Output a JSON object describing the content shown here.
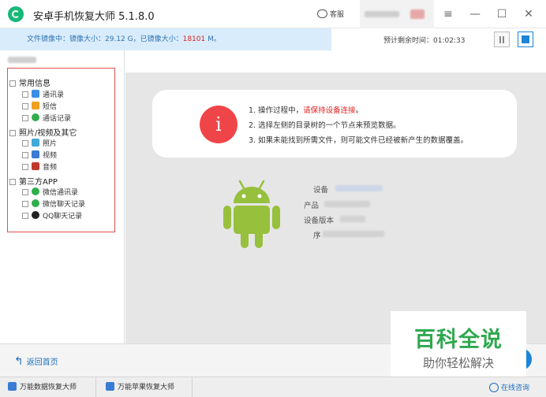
{
  "window": {
    "title": "安卓手机恢复大师  5.1.8.0",
    "support_label": "客服",
    "buttons": {
      "menu": "≡",
      "minimize": "—",
      "maximize": "☐",
      "close": "✕"
    }
  },
  "status": {
    "prefix": "文件镜像中：镜像大小：29.12 G，已镜像大小：",
    "mirrored_value": "18101",
    "suffix": " M。",
    "eta": "预计剩余时间：01:02:33"
  },
  "tree": {
    "categories": [
      {
        "label": "常用信息",
        "items": [
          {
            "label": "通讯录",
            "icon": "contacts-icon",
            "color": "#3a8ee6"
          },
          {
            "label": "短信",
            "icon": "sms-icon",
            "color": "#f0a020"
          },
          {
            "label": "通话记录",
            "icon": "call-log-icon",
            "color": "#2fae4a"
          }
        ]
      },
      {
        "label": "照片/视频及其它",
        "items": [
          {
            "label": "照片",
            "icon": "photo-icon",
            "color": "#3fa9d8"
          },
          {
            "label": "视频",
            "icon": "video-icon",
            "color": "#3a7bd5"
          },
          {
            "label": "音频",
            "icon": "audio-icon",
            "color": "#c0392b"
          }
        ]
      },
      {
        "label": "第三方APP",
        "items": [
          {
            "label": "微信通讯录",
            "icon": "wechat-icon",
            "color": "#2fae4a"
          },
          {
            "label": "微信聊天记录",
            "icon": "wechat-icon",
            "color": "#2fae4a"
          },
          {
            "label": "QQ聊天记录",
            "icon": "qq-icon",
            "color": "#222222"
          }
        ]
      }
    ]
  },
  "notice": {
    "line1_prefix": "1. 操作过程中，",
    "line1_red": "请保持设备连接",
    "line1_suffix": "。",
    "line2": "2. 选择左侧的目录树的一个节点来预览数据。",
    "line3": "3. 如果未能找到所需文件，则可能文件已经被新产生的数据覆盖。"
  },
  "device": {
    "label1": "设备",
    "label2": "产品",
    "label3": "设备版本",
    "label4": "序"
  },
  "footer": {
    "back_home": "返回首页",
    "tab1": "万能数据恢复大师",
    "tab2": "万能苹果恢复大师",
    "online": "在线咨询"
  },
  "watermark": {
    "big": "百科全说",
    "small": "助你轻松解决"
  },
  "colors": {
    "accent": "#1d84d8",
    "warn": "#ef4548",
    "android": "#97c03d"
  }
}
